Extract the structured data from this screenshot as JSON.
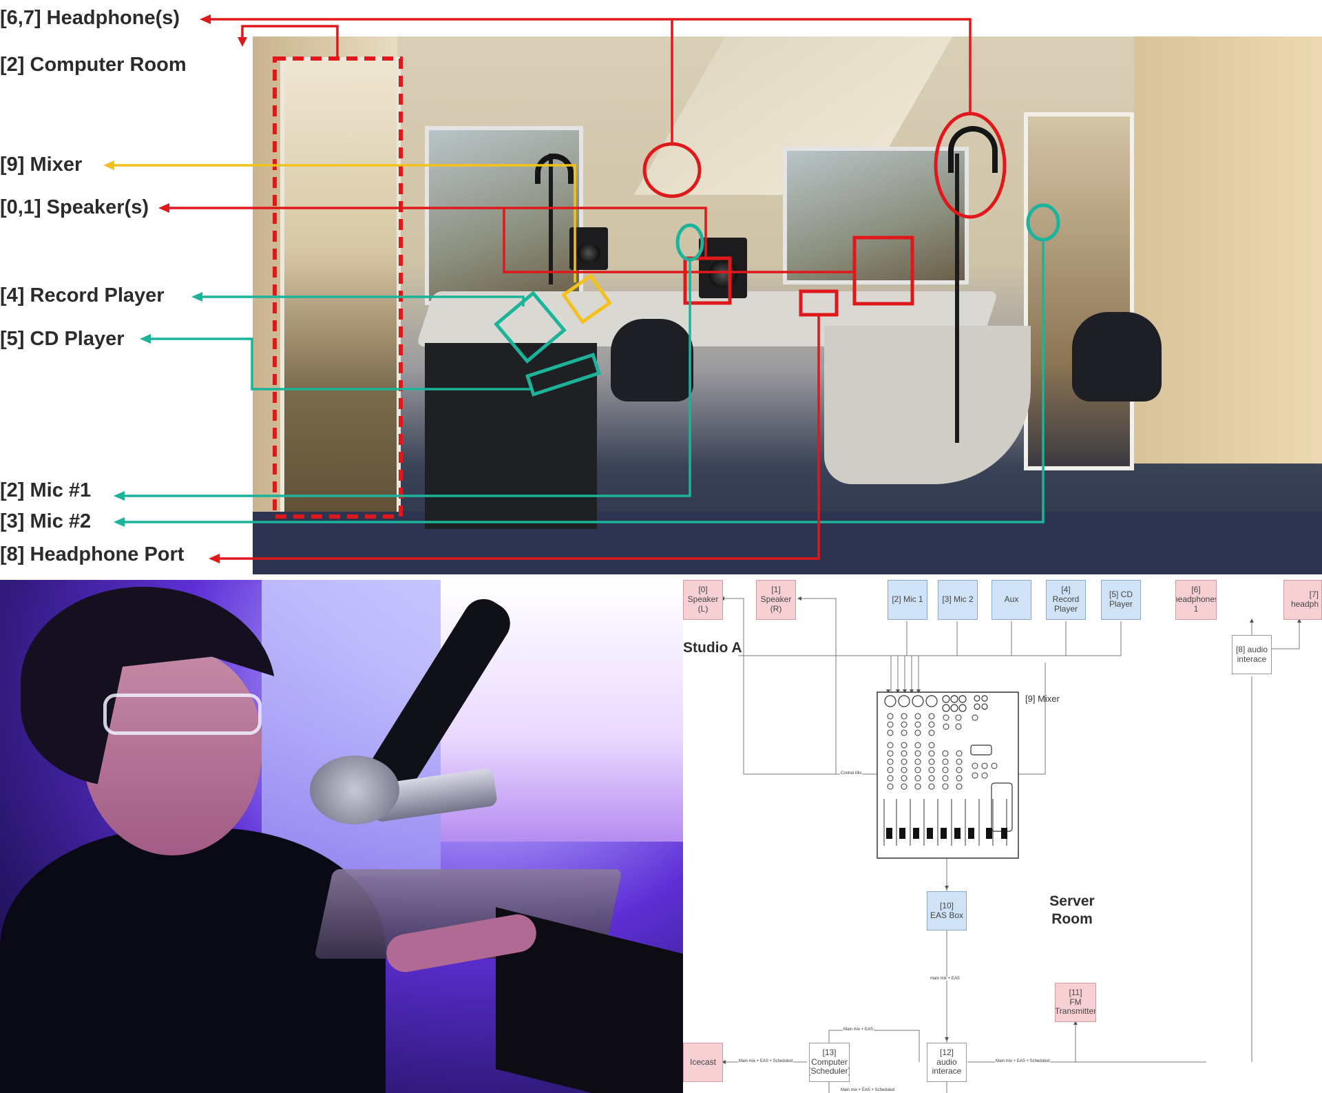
{
  "annotation_labels": [
    {
      "id": "headphones",
      "text": "[6,7] Headphone(s)",
      "color": "#e0181b"
    },
    {
      "id": "computer-room",
      "text": "[2] Computer Room",
      "color": "#e0181b"
    },
    {
      "id": "mixer",
      "text": "[9] Mixer",
      "color": "#f2c21b"
    },
    {
      "id": "speakers",
      "text": "[0,1] Speaker(s)",
      "color": "#e0181b"
    },
    {
      "id": "record-player",
      "text": "[4] Record Player",
      "color": "#1bb39a"
    },
    {
      "id": "cd-player",
      "text": "[5] CD Player",
      "color": "#1bb39a"
    },
    {
      "id": "mic1",
      "text": "[2] Mic #1",
      "color": "#1bb39a"
    },
    {
      "id": "mic2",
      "text": "[3] Mic #2",
      "color": "#1bb39a"
    },
    {
      "id": "headphone-port",
      "text": "[8] Headphone Port",
      "color": "#e0181b"
    }
  ],
  "diagram": {
    "rooms": {
      "studio": "Studio A",
      "server": "Server\nRoom"
    },
    "mixer_label": "[9] Mixer",
    "nodes": {
      "speaker_l": "[0]\nSpeaker\n(L)",
      "speaker_r": "[1]\nSpeaker\n(R)",
      "mic1": "[2] Mic 1",
      "mic2": "[3] Mic 2",
      "aux": "Aux",
      "record_player": "[4]\nRecord\nPlayer",
      "cd_player": "[5] CD\nPlayer",
      "headphones1": "[6]\nheadphones\n1",
      "headphones2": "[7]\nheadph",
      "audio_interface_8": "[8] audio\ninterace",
      "eas_box": "[10]\nEAS Box",
      "fm_transmitter": "[11]\nFM\nTransmitter",
      "audio_interface_12": "[12]\naudio\ninterace",
      "computer": "[13]\nComputer\n(Scheduler)",
      "icecast": "Icecast"
    },
    "edge_labels": {
      "control_mix": "Control Mix",
      "main_mix_eas": "main mix + EAS",
      "main_mix_eas_upper": "Main mix + EAS",
      "main_mix_eas_sched_left": "Main mix + EAS + Scheduled",
      "main_mix_eas_sched_right": "Main mix + EAS + Scheduled",
      "main_mix_eas_sched_bottom": "Main mix + EAS + Scheduled"
    }
  }
}
